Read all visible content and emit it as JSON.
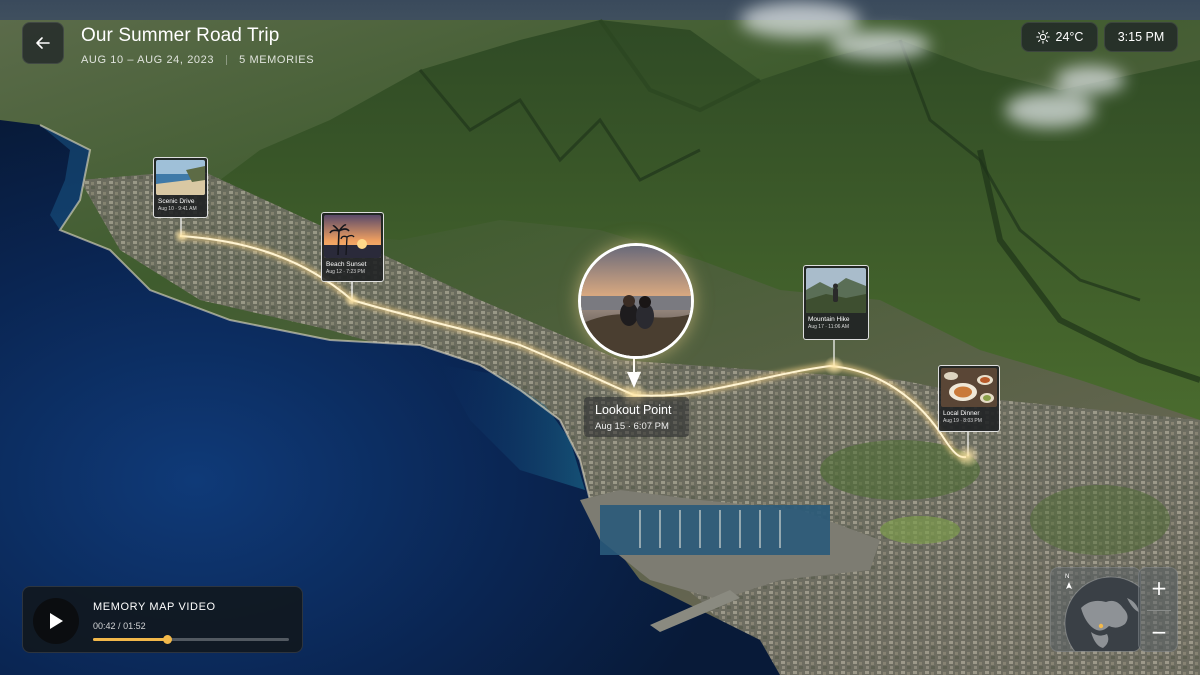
{
  "header": {
    "title": "Our Summer Road Trip",
    "dates": "AUG 10 – AUG 24, 2023",
    "memories": "5 MEMORIES"
  },
  "status": {
    "weather_icon": "sun-icon",
    "temperature": "24°C",
    "time": "3:15 PM"
  },
  "memories": [
    {
      "name": "Scenic Drive",
      "date": "Aug 10 · 9:41 AM",
      "icon": "beach-photo"
    },
    {
      "name": "Beach Sunset",
      "date": "Aug 12 · 7:23 PM",
      "icon": "sunset-photo"
    },
    {
      "name": "Lookout Point",
      "date": "Aug 15 · 6:07 PM",
      "icon": "couple-photo"
    },
    {
      "name": "Mountain Hike",
      "date": "Aug 17 · 11:06 AM",
      "icon": "hiker-photo"
    },
    {
      "name": "Local Dinner",
      "date": "Aug 19 · 8:03 PM",
      "icon": "dinner-photo"
    }
  ],
  "video": {
    "title": "MEMORY MAP VIDEO",
    "elapsed": "00:42",
    "duration": "01:52",
    "progress": 0.375
  },
  "map_controls": {
    "compass_label": "N",
    "zoom_in": "+",
    "zoom_out": "−"
  },
  "colors": {
    "route": "#ffd98a",
    "accent": "#f2b84a",
    "sea_deep": "#0a1d3f",
    "land": "#3e5a2c"
  }
}
